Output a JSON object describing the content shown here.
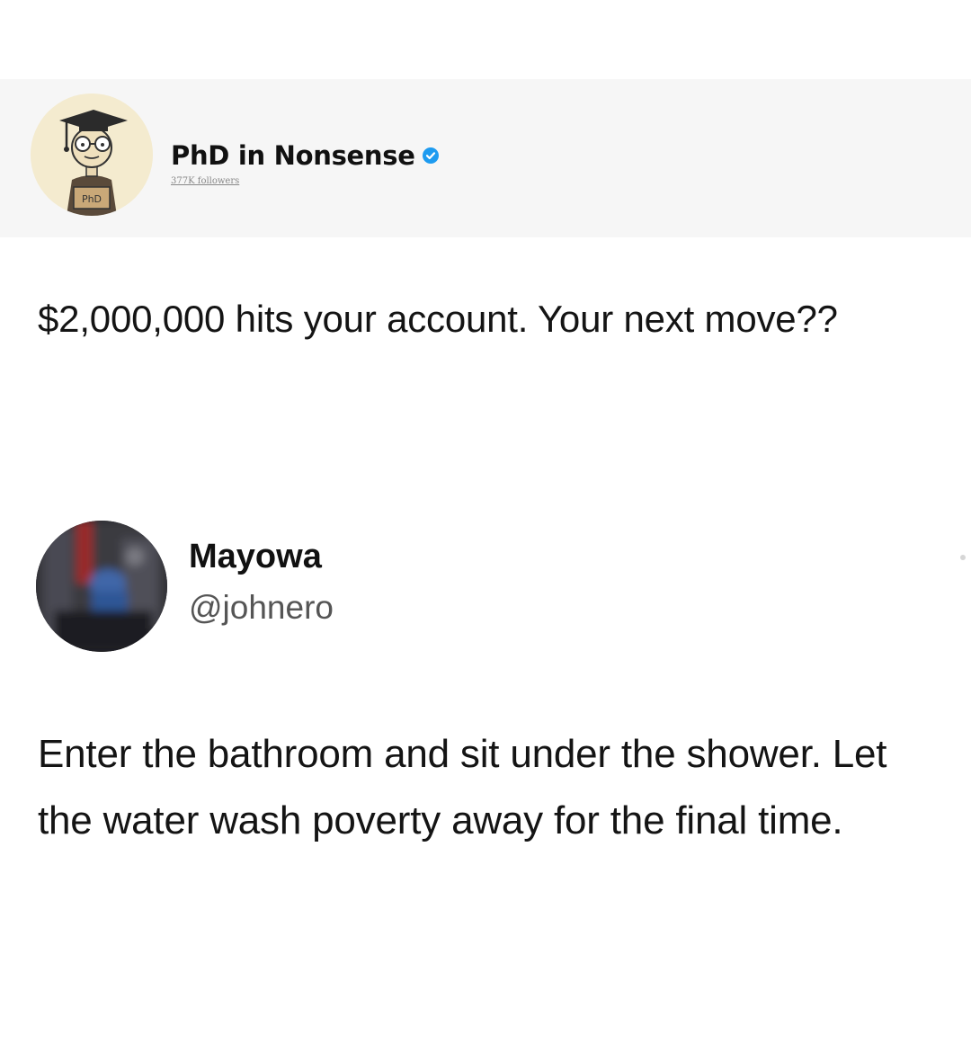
{
  "post1": {
    "author_name": "PhD in Nonsense",
    "followers": "377K followers",
    "verified": true,
    "text": "$2,000,000 hits your account. Your next move??",
    "avatar_icon": "graduate-cartoon-avatar",
    "avatar_sign_text": "PhD"
  },
  "post2": {
    "author_name": "Mayowa",
    "handle": "@johnero",
    "text": "Enter the bathroom and sit under the shower. Let the water wash poverty away for the final time.",
    "avatar_icon": "blurred-photo-avatar"
  },
  "colors": {
    "verified_blue": "#1d9bf0",
    "header_band": "#f6f6f6"
  }
}
